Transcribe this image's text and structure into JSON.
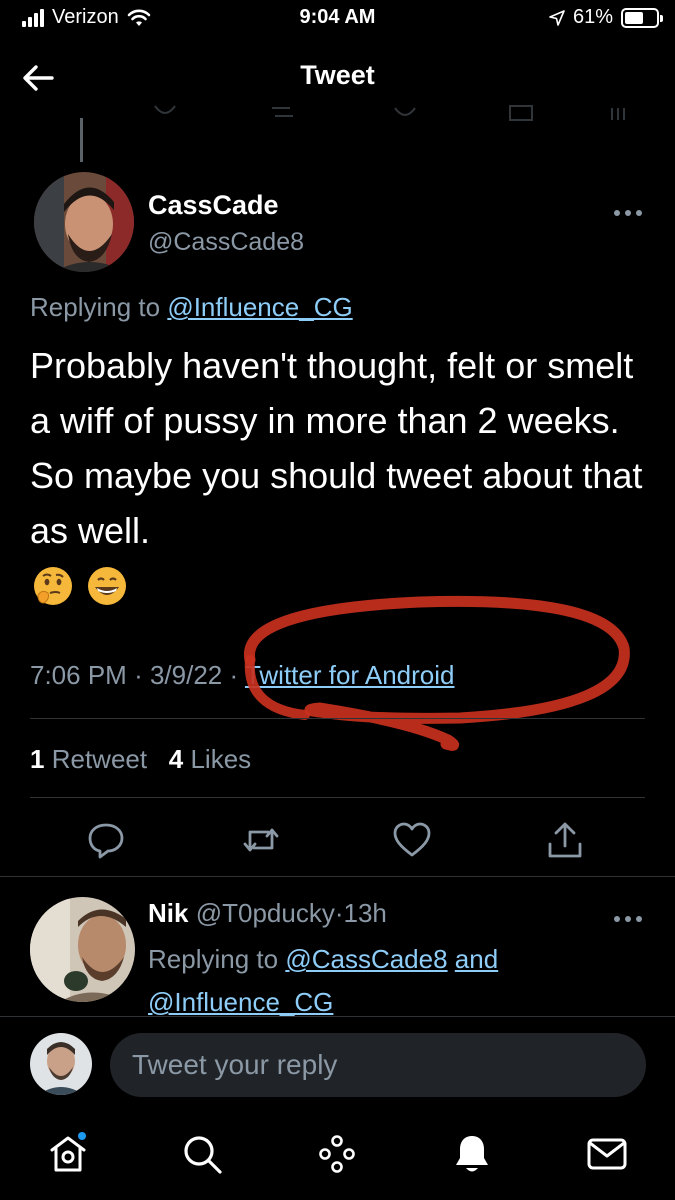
{
  "status_bar": {
    "carrier": "Verizon",
    "time": "9:04 AM",
    "battery": "61%",
    "battery_level": 0.61
  },
  "nav": {
    "title": "Tweet",
    "back_icon": "arrow-left-icon"
  },
  "tweet": {
    "author_name": "CassCade",
    "author_handle": "@CassCade8",
    "replying_prefix": "Replying to",
    "replying_to": "@Influence_CG",
    "text": "Probably haven't thought, felt or smelt a wiff of pussy in more than 2 weeks. So maybe you should tweet about that as well.",
    "emojis": [
      "thinking-face-emoji",
      "grinning-face-emoji"
    ],
    "time": "7:06 PM",
    "date": "3/9/22",
    "sep": "·",
    "source": "Twitter for Android",
    "retweet_count": "1",
    "retweet_label": "Retweet",
    "like_count": "4",
    "like_label": "Likes",
    "annotation_color": "#c8301e"
  },
  "reply": {
    "name": "Nik",
    "handle": "@T0pducky",
    "sep": "·",
    "age": "13h",
    "replying_prefix": "Replying to",
    "replying_to_1": "@CassCade8",
    "and": "and",
    "replying_to_2": "@Influence_CG"
  },
  "composer": {
    "placeholder": "Tweet your reply"
  },
  "colors": {
    "background": "#000000",
    "text": "#e7e9ea",
    "muted": "#8b98a5",
    "link": "#8ecdf8",
    "accent": "#1d9bf0",
    "divider": "#2f3336"
  }
}
